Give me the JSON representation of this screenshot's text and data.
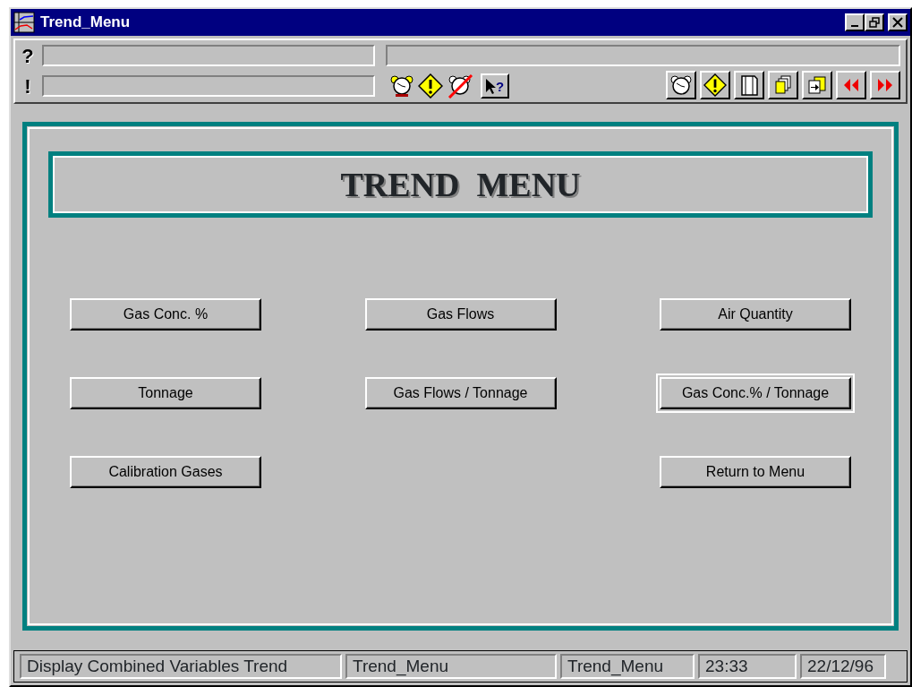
{
  "window": {
    "title": "Trend_Menu"
  },
  "message_rows": [
    {
      "label": "?"
    },
    {
      "label": "!"
    }
  ],
  "help_pointer_mark": "?",
  "heading": "TREND  MENU",
  "button_columns": [
    [
      {
        "label": "Gas Conc. %",
        "focused": false
      },
      {
        "label": "Tonnage",
        "focused": false
      },
      {
        "label": "Calibration Gases",
        "focused": false
      }
    ],
    [
      {
        "label": "Gas Flows",
        "focused": false
      },
      {
        "label": "Gas Flows / Tonnage",
        "focused": false
      }
    ],
    [
      {
        "label": "Air Quantity",
        "focused": false
      },
      {
        "label": "Gas Conc.% / Tonnage",
        "focused": true
      },
      {
        "label": "Return to Menu",
        "focused": false
      }
    ]
  ],
  "status_bar": [
    "Display Combined Variables Trend",
    "Trend_Menu",
    "Trend_Menu",
    "23:33",
    "22/12/96"
  ]
}
